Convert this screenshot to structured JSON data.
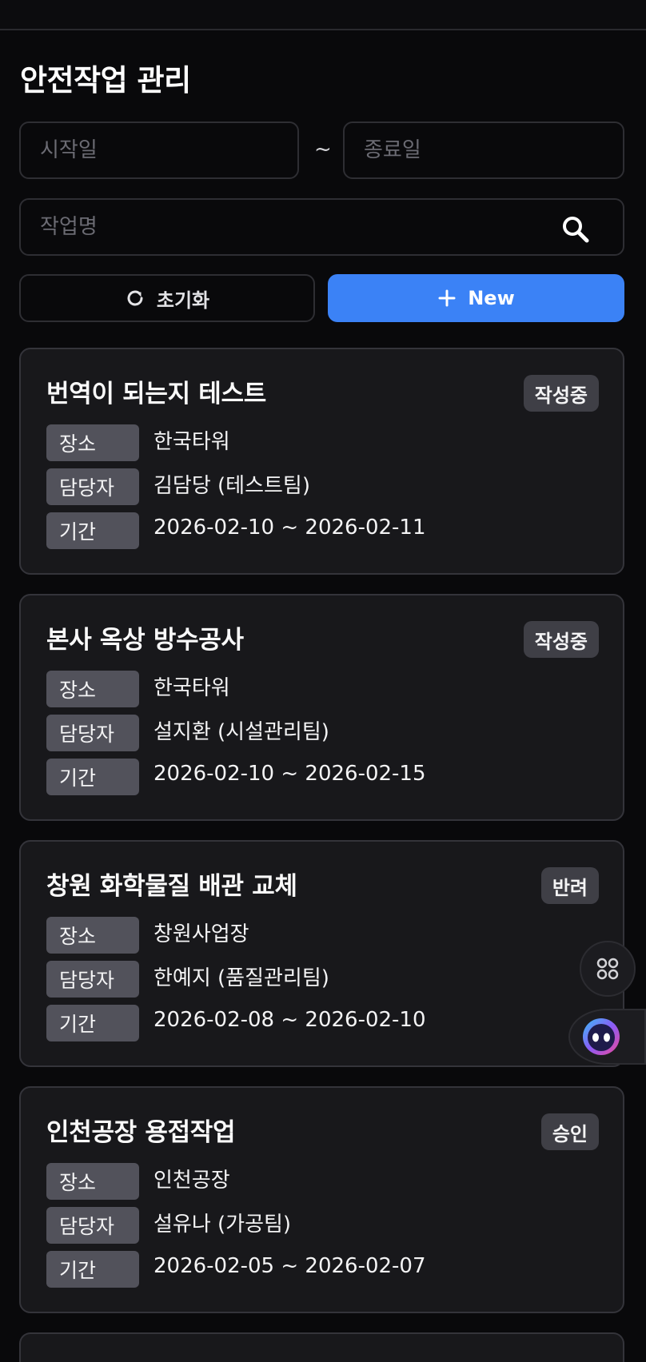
{
  "page": {
    "title": "안전작업 관리"
  },
  "filters": {
    "start_placeholder": "시작일",
    "separator": "~",
    "end_placeholder": "종료일",
    "search_placeholder": "작업명"
  },
  "actions": {
    "reset_label": "초기화",
    "new_label": "New"
  },
  "field_labels": {
    "location": "장소",
    "manager": "담당자",
    "period": "기간"
  },
  "cards": [
    {
      "title": "번역이 되는지 테스트",
      "status": "작성중",
      "location": "한국타워",
      "manager": "김담당 (테스트팀)",
      "period": "2026-02-10 ~ 2026-02-11"
    },
    {
      "title": "본사 옥상 방수공사",
      "status": "작성중",
      "location": "한국타워",
      "manager": "설지환 (시설관리팀)",
      "period": "2026-02-10 ~ 2026-02-15"
    },
    {
      "title": "창원 화학물질 배관 교체",
      "status": "반려",
      "location": "창원사업장",
      "manager": "한예지 (품질관리팀)",
      "period": "2026-02-08 ~ 2026-02-10"
    },
    {
      "title": "인천공장 용접작업",
      "status": "승인",
      "location": "인천공장",
      "manager": "설유나 (가공팀)",
      "period": "2026-02-05 ~ 2026-02-07"
    }
  ],
  "icons": {
    "search": "search-icon",
    "reset": "refresh-icon",
    "new": "plus-icon",
    "apps": "apps-grid-icon",
    "assistant": "assistant-bot-icon"
  },
  "colors": {
    "accent": "#3b82f6",
    "background": "#09090b",
    "card": "#18181b",
    "badge": "#3f3f46"
  }
}
